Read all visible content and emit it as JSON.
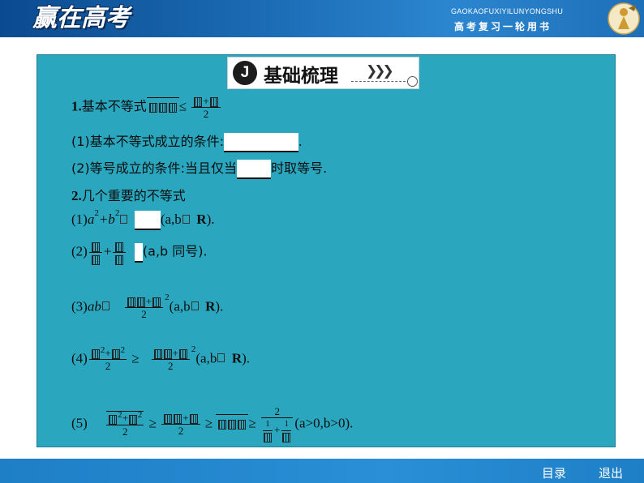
{
  "header": {
    "logo_text": "赢在高考",
    "brand_en": "GAOKAOFUXIYILUNYONGSHU",
    "brand_cn": "高考复习一轮用书"
  },
  "section": {
    "badge": "J",
    "title": "基础梳理"
  },
  "content": {
    "item1": {
      "num": "1",
      "text": "基本不等式",
      "sym": "≤",
      "den": "2"
    },
    "item1a": {
      "text_before": "(1)基本不等式成立的条件:",
      "text_after": "."
    },
    "item1b": {
      "text_before": "(2)等号成立的条件:当且仅当",
      "text_after": "时取等号."
    },
    "item2": {
      "num": "2",
      "text": "几个重要的不等式"
    },
    "ineq1": {
      "label": "(1)",
      "expr": "a",
      "plus": "+b",
      "exp": "2",
      "tail": "(a,b",
      "domain": "R",
      "close": ")."
    },
    "ineq2": {
      "label": "(2)",
      "plus": "+",
      "tail": "(a,b 同号)."
    },
    "ineq3": {
      "label": "(3)",
      "expr": "ab",
      "exp": "2",
      "den": "2",
      "tail": "(a,b",
      "domain": "R",
      "close": ")."
    },
    "ineq4": {
      "label": "(4)",
      "exp": "2",
      "den": "2",
      "geq": "≥",
      "tail": "(a,b",
      "domain": "R",
      "close": ")."
    },
    "ineq5": {
      "label": "(5)",
      "exp": "2",
      "den": "2",
      "geq": "≥",
      "two": "2",
      "one": "1",
      "tail": "(a>0,b>0)."
    }
  },
  "footer": {
    "contents_label": "目录",
    "exit_label": "退出"
  }
}
